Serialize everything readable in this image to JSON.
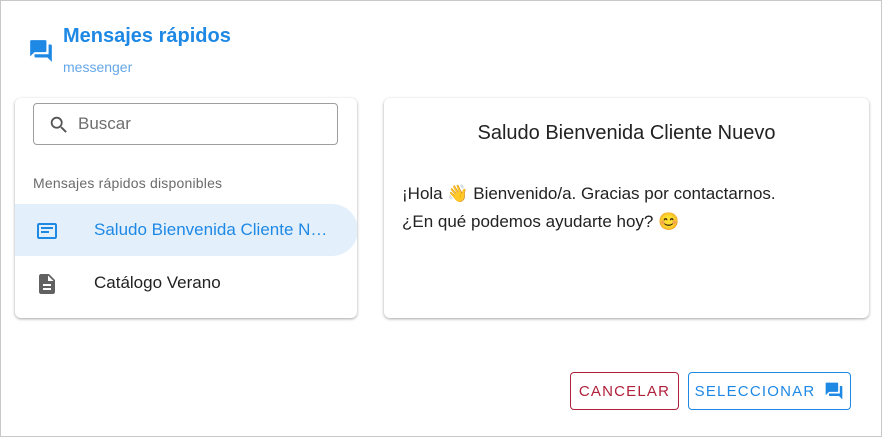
{
  "header": {
    "icon": "quick-messages-icon",
    "title": "Mensajes rápidos",
    "subtitle": "messenger"
  },
  "search": {
    "placeholder": "Buscar",
    "value": ""
  },
  "list": {
    "section_label": "Mensajes rápidos disponibles",
    "items": [
      {
        "label": "Saludo Bienvenida Cliente Nuevo",
        "icon": "message-text-icon",
        "selected": true
      },
      {
        "label": "Catálogo Verano",
        "icon": "document-icon",
        "selected": false
      }
    ]
  },
  "preview": {
    "title": "Saludo Bienvenida Cliente Nuevo",
    "line1": "¡Hola 👋 Bienvenido/a. Gracias por contactarnos.",
    "line2": "¿En qué podemos ayudarte hoy? 😊"
  },
  "buttons": {
    "cancel_label": "CANCELAR",
    "select_label": "SELECCIONAR"
  },
  "colors": {
    "accent": "#1e88e5",
    "danger": "#b0203a",
    "selected_bg": "#e3f0fc"
  }
}
